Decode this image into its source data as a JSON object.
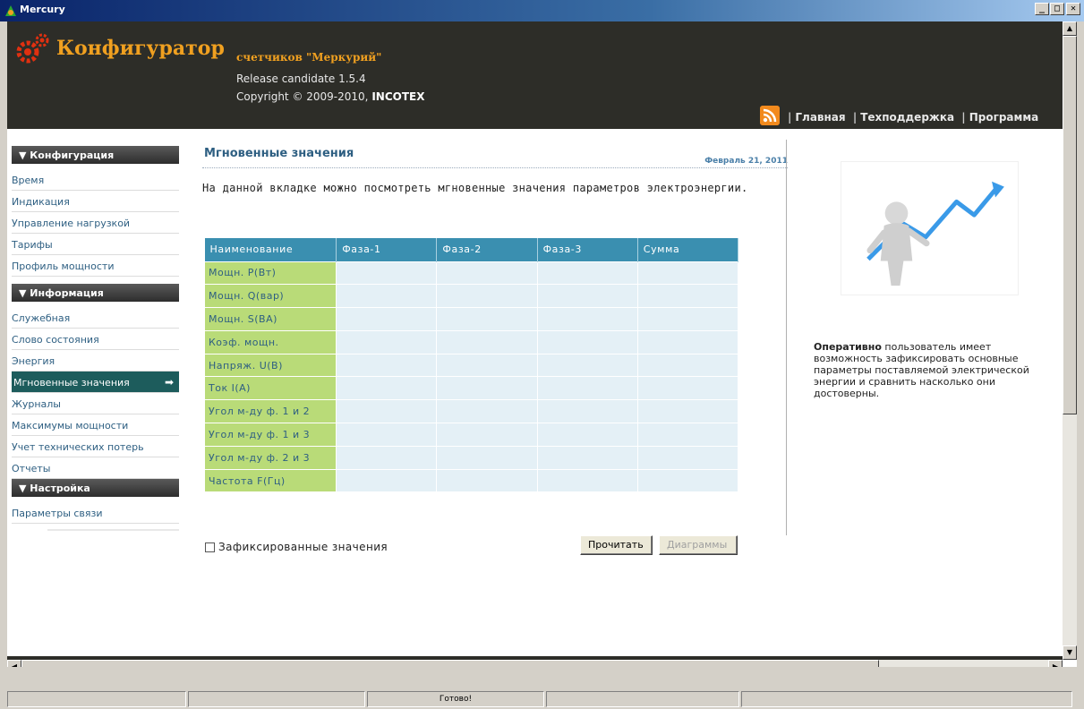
{
  "window": {
    "title": "Mercury",
    "buttons": [
      "_",
      "□",
      "✕"
    ]
  },
  "header": {
    "brand": "Конфигуратор",
    "brand_sub": "счетчиков \"Меркурий\"",
    "release": "Release candidate 1.5.4",
    "copyright_prefix": "Copyright © 2009-2010, ",
    "copyright_company": "INCOTEX",
    "nav": [
      "Главная",
      "Техподдержка",
      "Программа"
    ],
    "rss_icon": "rss-icon"
  },
  "sidebar": {
    "sections": [
      {
        "title": "▼ Конфигурация",
        "items": [
          "Время",
          "Индикация",
          "Управление нагрузкой",
          "Тарифы",
          "Профиль мощности"
        ]
      },
      {
        "title": "▼ Информация",
        "items": [
          "Служебная",
          "Слово состояния",
          "Энергия",
          "Мгновенные значения",
          "Журналы",
          "Максимумы мощности",
          "Учет технических потерь",
          "Отчеты"
        ]
      },
      {
        "title": "▼ Настройка",
        "items": [
          "Параметры связи"
        ]
      }
    ],
    "active_item": "Мгновенные значения"
  },
  "main": {
    "title": "Мгновенные значения",
    "date": "Февраль 21, 2011",
    "intro": "На данной вкладке можно посмотреть мгновенные значения параметров электроэнергии.",
    "table": {
      "headers": [
        "Наименование",
        "Фаза-1",
        "Фаза-2",
        "Фаза-3",
        "Сумма"
      ],
      "rows": [
        "Мощн. P(Вт)",
        "Мощн. Q(вар)",
        "Мощн. S(ВА)",
        "Коэф. мощн.",
        "Напряж. U(В)",
        "Ток I(А)",
        "Угол м-ду ф. 1 и 2",
        "Угол м-ду ф. 1 и 3",
        "Угол м-ду ф. 2 и 3",
        "Частота F(Гц)"
      ]
    },
    "fixed_values_label": "Зафиксированные значения",
    "read_button": "Прочитать",
    "diagrams_button": "Диаграммы"
  },
  "promo": {
    "bold": "Оперативно",
    "text": " пользователь имеет возможность зафиксировать основные параметры поставляемой электрической энергии и сравнить насколько они достоверны."
  },
  "statusbar": {
    "panes": [
      "",
      "",
      "Готово!",
      "",
      ""
    ]
  },
  "colors": {
    "header_bg": "#2d2d28",
    "brand": "#f0a020",
    "table_head": "#3a8fb0",
    "name_cell": "#b9db78",
    "active_item": "#1d5c5c"
  }
}
